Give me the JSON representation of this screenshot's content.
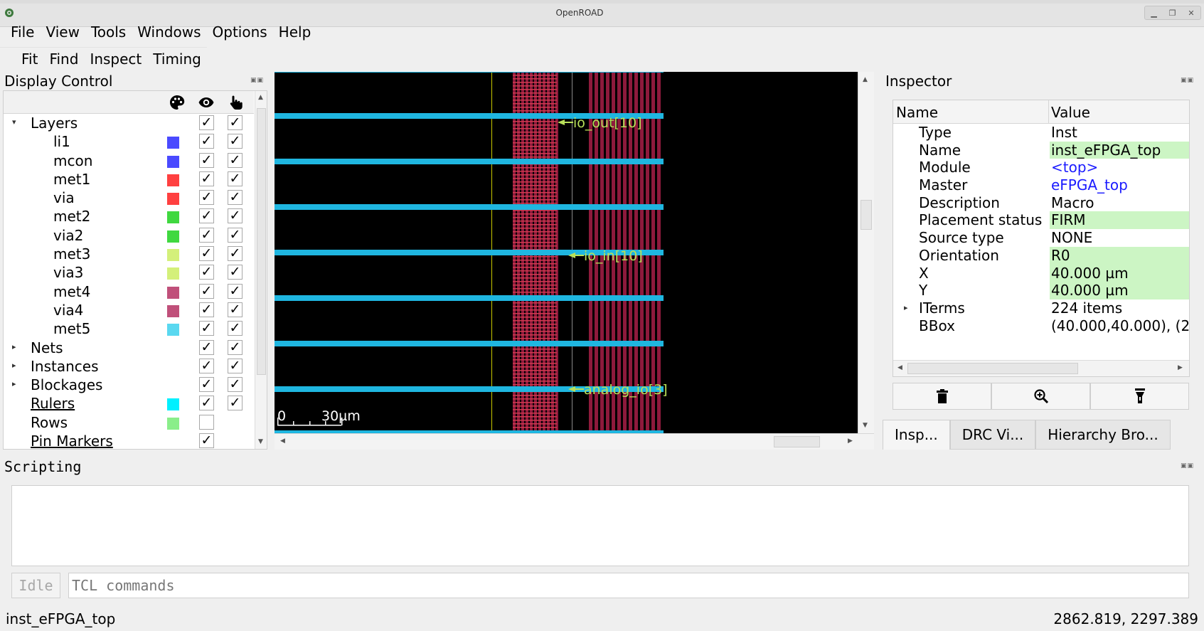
{
  "window": {
    "title": "OpenROAD"
  },
  "menu": {
    "file": "File",
    "view": "View",
    "tools": "Tools",
    "windows": "Windows",
    "options": "Options",
    "help": "Help"
  },
  "toolbar": {
    "fit": "Fit",
    "find": "Find",
    "inspect": "Inspect",
    "timing": "Timing"
  },
  "display_control": {
    "title": "Display Control",
    "header_icons": [
      "palette-icon",
      "eye-icon",
      "pointer-hand-icon"
    ],
    "rows": [
      {
        "label": "Layers",
        "expandable": "expanded",
        "indent": 0,
        "visible": "✓",
        "selectable": "✓"
      },
      {
        "label": "li1",
        "indent": 1,
        "color": "#4a4aff",
        "visible": "✓",
        "selectable": "✓"
      },
      {
        "label": "mcon",
        "indent": 1,
        "color": "#4a4aff",
        "visible": "✓",
        "selectable": "✓"
      },
      {
        "label": "met1",
        "indent": 1,
        "color": "#ff4040",
        "visible": "✓",
        "selectable": "✓"
      },
      {
        "label": "via",
        "indent": 1,
        "color": "#ff4040",
        "visible": "✓",
        "selectable": "✓"
      },
      {
        "label": "met2",
        "indent": 1,
        "color": "#40d840",
        "visible": "✓",
        "selectable": "✓"
      },
      {
        "label": "via2",
        "indent": 1,
        "color": "#40d840",
        "visible": "✓",
        "selectable": "✓"
      },
      {
        "label": "met3",
        "indent": 1,
        "color": "#d4f07a",
        "visible": "✓",
        "selectable": "✓"
      },
      {
        "label": "via3",
        "indent": 1,
        "color": "#d4f07a",
        "visible": "✓",
        "selectable": "✓"
      },
      {
        "label": "met4",
        "indent": 1,
        "color": "#c0507a",
        "visible": "✓",
        "selectable": "✓"
      },
      {
        "label": "via4",
        "indent": 1,
        "color": "#c0507a",
        "visible": "✓",
        "selectable": "✓"
      },
      {
        "label": "met5",
        "indent": 1,
        "color": "#5ad8f0",
        "visible": "✓",
        "selectable": "✓"
      },
      {
        "label": "Nets",
        "expandable": "collapsed",
        "indent": 0,
        "visible": "✓",
        "selectable": "✓"
      },
      {
        "label": "Instances",
        "expandable": "collapsed",
        "indent": 0,
        "visible": "✓",
        "selectable": "✓"
      },
      {
        "label": "Blockages",
        "expandable": "collapsed",
        "indent": 0,
        "visible": "✓",
        "selectable": "✓"
      },
      {
        "label": "Rulers",
        "indent": 0,
        "underline": "yes",
        "color": "#00f0ff",
        "visible": "✓",
        "selectable": "✓"
      },
      {
        "label": "Rows",
        "indent": 0,
        "color": "#8aee8a",
        "visible": "",
        "selectable": "none"
      },
      {
        "label": "Pin Markers",
        "indent": 0,
        "underline": "yes",
        "visible": "✓",
        "selectable": "none"
      }
    ]
  },
  "layout_view": {
    "pins": [
      {
        "label": "io_out[10]"
      },
      {
        "label": "io_in[10]"
      },
      {
        "label": "analog_io[3]"
      }
    ],
    "scale_bar": {
      "start_label": "0",
      "end_label": "30µm"
    },
    "colors": {
      "background": "#000000",
      "met5": "#1fb6e0",
      "met4": "#8e1a3c",
      "label": "#b8e05a"
    }
  },
  "inspector": {
    "title": "Inspector",
    "columns": {
      "name": "Name",
      "value": "Value"
    },
    "rows": [
      {
        "key": "Type",
        "value": "Inst",
        "style": "plain"
      },
      {
        "key": "Name",
        "value": "inst_eFPGA_top",
        "style": "highlight"
      },
      {
        "key": "Module",
        "value": "<top>",
        "style": "link"
      },
      {
        "key": "Master",
        "value": "eFPGA_top",
        "style": "link"
      },
      {
        "key": "Description",
        "value": "Macro",
        "style": "plain"
      },
      {
        "key": "Placement status",
        "value": "FIRM",
        "style": "highlight"
      },
      {
        "key": "Source type",
        "value": "NONE",
        "style": "plain"
      },
      {
        "key": "Orientation",
        "value": "R0",
        "style": "highlight"
      },
      {
        "key": "X",
        "value": "40.000 µm",
        "style": "highlight"
      },
      {
        "key": "Y",
        "value": "40.000 µm",
        "style": "highlight"
      },
      {
        "key": "ITerms",
        "value": "224 items",
        "style": "plain",
        "expandable": "collapsed"
      },
      {
        "key": "BBox",
        "value": "(40.000,40.000), (2",
        "style": "plain"
      }
    ],
    "buttons": [
      "trash-icon",
      "zoom-in-icon",
      "highlight-icon"
    ],
    "tabs": [
      "Insp...",
      "DRC Vi...",
      "Hierarchy Bro..."
    ]
  },
  "scripting": {
    "title": "Scripting",
    "idle_label": "Idle",
    "input_placeholder": "TCL commands"
  },
  "status": {
    "left": "inst_eFPGA_top",
    "right": "2862.819, 2297.389"
  }
}
